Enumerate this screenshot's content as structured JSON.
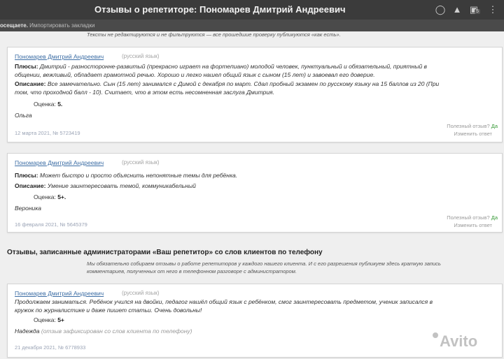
{
  "window": {
    "title": "Отзывы о репетиторе: Пономарев Дмитрий Андреевич",
    "badge_count": "5"
  },
  "bookmarks_bar": {
    "left_text": "осещаете.",
    "import_label": "Импортировать закладки"
  },
  "notice": "Тексты не редактируются и не фильтруются — все прошедшие проверку публикуются «как есть».",
  "reviews": [
    {
      "name": "Пономарев Дмитрий Андреевич",
      "subject": "(русский язык)",
      "pros_label": "Плюсы:",
      "pros_line1": "Дмитрий - разносторонне-развитый (прекрасно играет на фортепиано) молодой человек, пунктуальный и обязательный, приятный в",
      "pros_line2": "общении, вежливый, обладает грамотной речью. Хорошо и легко нашел общий язык с сыном (15 лет) и завоевал его доверие.",
      "desc_label": "Описание:",
      "desc_line1": "Все замечательно. Сын (15 лет) занимался с Димой с декабря по март. Сдал пробный экзамен по русскому языку на 15 баллов из 20 (При",
      "desc_line2": "том, что проходной балл - 10). Считает, что в этом есть несомненная заслуга Дмитрия.",
      "rating_label": "Оценка:",
      "rating_value": "5.",
      "author": "Ольга",
      "date": "12 марта 2021, № 5723419",
      "useful_q": "Полезный отзыв?",
      "useful_yes": "Да",
      "reply": "Изменить ответ"
    },
    {
      "name": "Пономарев Дмитрий Андреевич",
      "subject": "(русский язык)",
      "pros_label": "Плюсы:",
      "pros_line1": "Может быстро и просто объяснить непонятные темы для ребёнка.",
      "desc_label": "Описание:",
      "desc_line1": "Умение заинтересовать темой, коммуникабельный",
      "rating_label": "Оценка:",
      "rating_value": "5+.",
      "author": "Вероника",
      "date": "16 февраля 2021, № 5645379",
      "useful_q": "Полезный отзыв?",
      "useful_yes": "Да",
      "reply": "Изменить ответ"
    },
    {
      "name": "Пономарев Дмитрий Андреевич",
      "subject": "(русский язык)",
      "text_line1": "Продолжаем заниматься. Ребёнок учился на двойки, педагог нашёл общий язык с ребёнком, смог заинтересовать предметом, ученик записался в",
      "text_line2": "кружок по журналистике и даже пишет статьи. Очень довольны!",
      "rating_label": "Оценка:",
      "rating_value": "5+",
      "author": "Надежда",
      "author_note": "(отзыв зафиксирован со слов клиента по телефону)",
      "date": "21 декабря 2021, № 6778933"
    }
  ],
  "section": {
    "title": "Отзывы, записанные администраторами «Ваш репетитор» со слов клиентов по телефону",
    "note": "Мы обязательно собираем отзывы о работе репетиторов у каждого нашего клиента. И с его разрешения публикуем здесь краткую запись комментариев, полученных от него в телефонном разговоре с администратором."
  },
  "watermark": "Avito"
}
